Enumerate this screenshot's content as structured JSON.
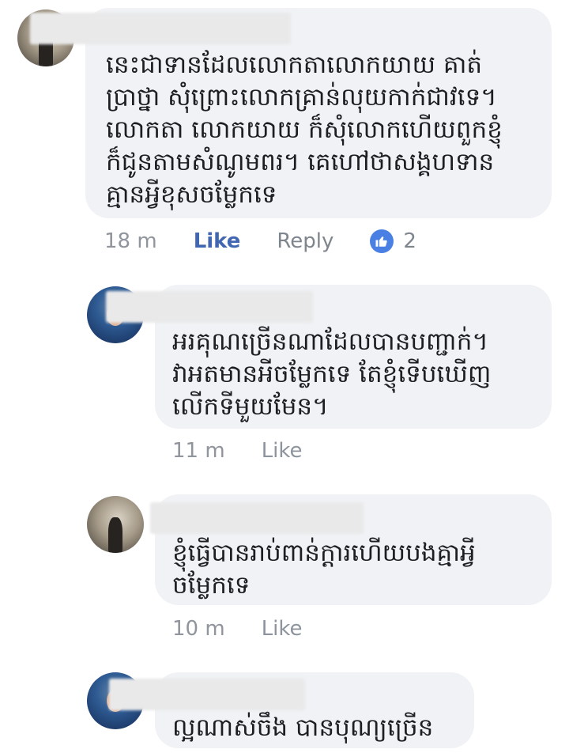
{
  "comments": [
    {
      "text": "នេះជាទានដែលលោកតាលោកយាយ គាត់\nប្រាថ្នា សុំព្រោះលោកគ្រាន់លុយកាក់ជាវទេ។\nលោកតា លោកយាយ ក៏សុំលោកហើយពួកខ្ញុំ\nក៏ជូនតាមសំណូមពរ។ គេហៅថាសង្គហទាន\nគ្មានអ្វីខុសចម្លែកទេ",
      "time": "18 m",
      "like": "Like",
      "reply": "Reply",
      "reactions": "2"
    },
    {
      "text": "អរគុណច្រើនណាដែលបានបញ្ជាក់។\nវាអតមានអីចម្លែកទេ តែខ្ញុំទើបឃើញ\nលើកទីមួយមែន។",
      "time": "11 m",
      "like": "Like"
    },
    {
      "text": "ខ្ញុំធ្វើបានរាប់ពាន់ក្តារហើយបងគ្មាអ្វី\nចម្លែកទេ",
      "time": "10 m",
      "like": "Like"
    },
    {
      "text": "ល្អណាស់ចឹង បានបុណ្យច្រើន"
    }
  ],
  "colors": {
    "bubble": "#f0f2f5",
    "like_active": "#4267b2",
    "reaction_thumb": "#4a7fe3",
    "meta": "#8d949e"
  },
  "icons": {
    "reaction": "thumbs-up-icon"
  }
}
